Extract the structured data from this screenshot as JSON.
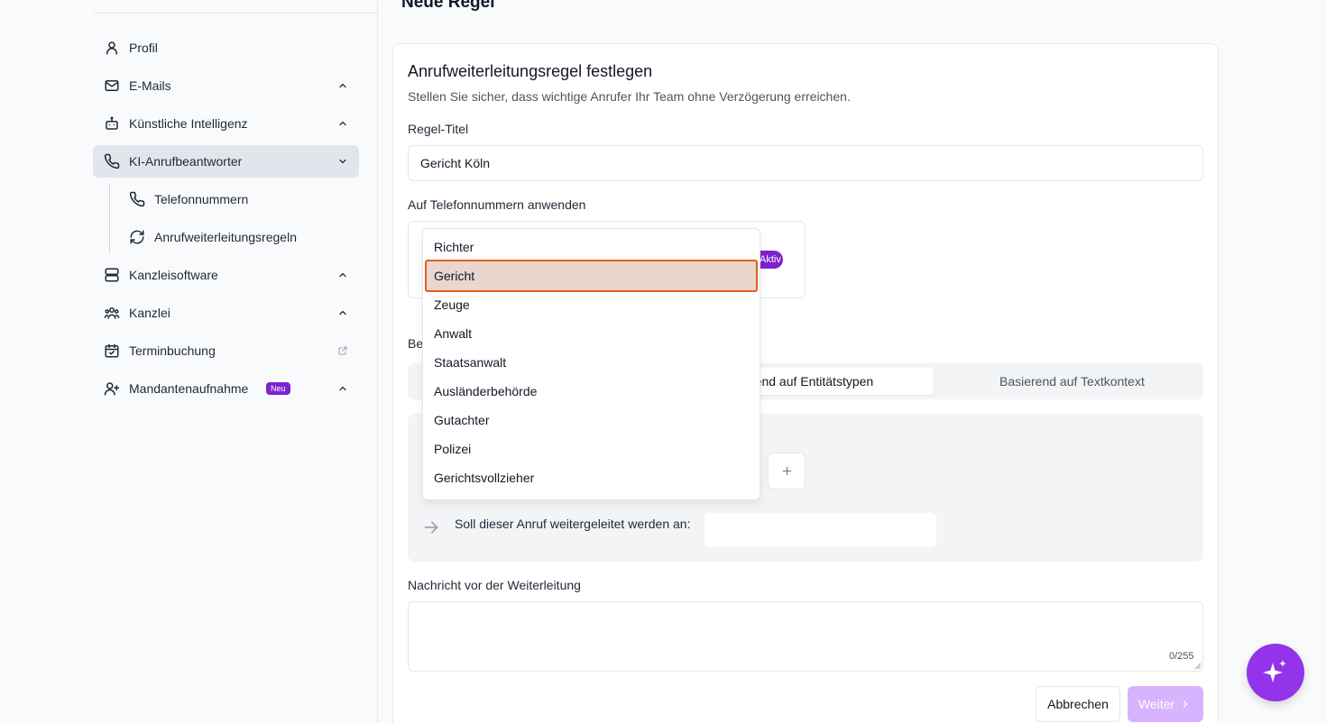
{
  "page": {
    "title": "Neue Regel"
  },
  "sidebar": {
    "items": [
      {
        "label": "Profil",
        "icon": "user-icon"
      },
      {
        "label": "E-Mails",
        "icon": "mail-icon"
      },
      {
        "label": "Künstliche Intelligenz",
        "icon": "bot-icon"
      },
      {
        "label": "KI-Anrufbeantworter",
        "icon": "phone-icon",
        "active": true
      },
      {
        "label": "Kanzleisoftware",
        "icon": "server-icon"
      },
      {
        "label": "Kanzlei",
        "icon": "users-icon"
      },
      {
        "label": "Terminbuchung",
        "icon": "calendar-check-icon"
      },
      {
        "label": "Mandantenaufnahme",
        "icon": "user-plus-icon",
        "badge": "Neu"
      }
    ],
    "subitems": [
      {
        "label": "Telefonnummern",
        "icon": "phone-icon"
      },
      {
        "label": "Anrufweiterleitungsregeln",
        "icon": "refresh-icon"
      }
    ]
  },
  "form": {
    "card_title": "Anrufweiterleitungsregel festlegen",
    "card_subtitle": "Stellen Sie sicher, dass wichtige Anrufer Ihr Team ohne Verzögerung erreichen.",
    "rule_title_label": "Regel-Titel",
    "rule_title_value": "Gericht Köln",
    "phones_label": "Auf Telefonnummern anwenden",
    "aktiv_badge": "Aktiv",
    "be_label_partial": "Be",
    "tabs": [
      {
        "label": "Basierend auf Entitätstypen",
        "visible_label": "rend auf Entitätstypen",
        "active": true
      },
      {
        "label": "Basierend auf Textkontext",
        "active": false
      }
    ],
    "forward_question": "Soll dieser Anruf weitergeleitet werden an:",
    "message_label": "Nachricht vor der Weiterleitung",
    "message_value": "",
    "message_counter": "0/255",
    "cancel_label": "Abbrechen",
    "next_label": "Weiter"
  },
  "dropdown": {
    "options": [
      "Richter",
      "Gericht",
      "Zeuge",
      "Anwalt",
      "Staatsanwalt",
      "Ausländerbehörde",
      "Gutachter",
      "Polizei",
      "Gerichtsvollzieher"
    ],
    "highlighted": "Gericht"
  },
  "colors": {
    "accent": "#9333ea",
    "badge": "#7e22ce",
    "disabled_button": "#d8b4fe",
    "highlight_border": "#e0601a",
    "highlight_fill": "#ead6cc"
  }
}
